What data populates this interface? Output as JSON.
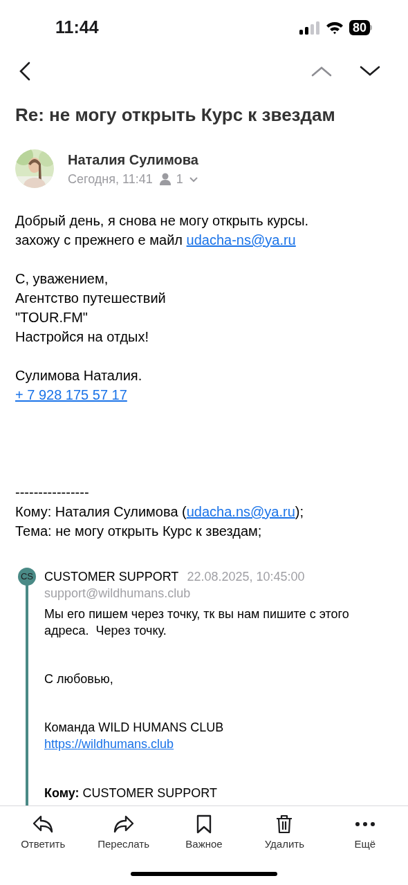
{
  "status_bar": {
    "time": "11:44",
    "battery": "80"
  },
  "subject": "Re: не могу открыть Курс к звездам",
  "sender": {
    "name": "Наталия Сулимова",
    "date": "Сегодня, 11:41",
    "recipients": "1"
  },
  "body": [
    [
      {
        "text": "Добрый день, я снова не могу открыть курсы."
      },
      {
        "text": "захожу с прежнего е майл ",
        "link": "udacha-ns@ya.ru"
      }
    ],
    [
      {
        "text": "С, уважением,"
      },
      {
        "text": "Агентство путешествий"
      },
      {
        "text": "\"TOUR.FM\""
      },
      {
        "text": "Настройся на отдых!"
      }
    ],
    [
      {
        "text": "Сулимова Наталия."
      },
      {
        "link": "+ 7 928 175 57 17"
      }
    ]
  ],
  "forward": {
    "divider": "----------------",
    "to_label": "Кому: Наталия Сулимова (",
    "to_link": "udacha.ns@ya.ru",
    "to_end": ");",
    "subject": "Тема: не могу открыть Курс к звездам;"
  },
  "quote": {
    "initials": "CS",
    "from": "CUSTOMER SUPPORT",
    "date": "22.08.2025, 10:45:00",
    "email": "support@wildhumans.club",
    "paragraphs": [
      [
        "Мы его пишем через точку, тк вы нам пишите с этого адреса.  Через точку."
      ],
      [
        "С любовью,"
      ],
      [
        "Команда WILD HUMANS CLUB"
      ]
    ],
    "link": "https://wildhumans.club",
    "to_label": "Кому:",
    "to_value": " CUSTOMER SUPPORT"
  },
  "toolbar": [
    {
      "kind": "reply",
      "label": "Ответить"
    },
    {
      "kind": "forward",
      "label": "Переслать"
    },
    {
      "kind": "bookmark",
      "label": "Важное"
    },
    {
      "kind": "trash",
      "label": "Удалить"
    },
    {
      "kind": "more",
      "label": "Ещё"
    }
  ]
}
